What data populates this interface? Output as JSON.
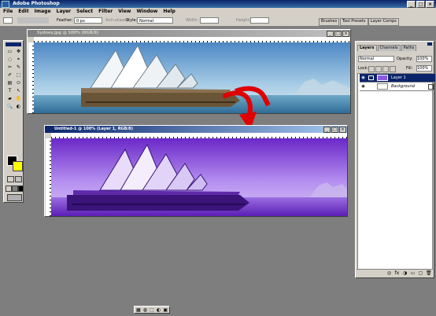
{
  "app": {
    "title": "Adobe Photoshop",
    "min": "_",
    "max": "□",
    "close": "×"
  },
  "menu": [
    "File",
    "Edit",
    "Image",
    "Layer",
    "Select",
    "Filter",
    "View",
    "Window",
    "Help"
  ],
  "options": {
    "feather_label": "Feather:",
    "feather_value": "0 px",
    "antialias_label": "Anti-aliased",
    "style_label": "Style:",
    "style_value": "Normal",
    "width_label": "Width:",
    "height_label": "Height:",
    "wells": [
      "Brushes",
      "Tool Presets",
      "Layer Comps"
    ]
  },
  "toolbox": {
    "tools": [
      "▭",
      "✥",
      "◌",
      "⌖",
      "✂",
      "✎",
      "✐",
      "⬚",
      "▤",
      "⬭",
      "T",
      "↖",
      "▰",
      "✋",
      "🔍",
      "◐"
    ],
    "fg_color": "#000000",
    "bg_color": "#ffff00"
  },
  "doc1": {
    "title": "Sydney.jpg @ 100% (RGB/8)",
    "min": "_",
    "max": "□",
    "close": "×"
  },
  "doc2": {
    "title": "Untitled-1 @ 100% (Layer 1, RGB/8)",
    "min": "_",
    "max": "□",
    "close": "×"
  },
  "layers_panel": {
    "tabs": [
      "Layers",
      "Channels",
      "Paths"
    ],
    "blend_mode": "Normal",
    "opacity_label": "Opacity:",
    "opacity_value": "100%",
    "lock_label": "Lock:",
    "fill_label": "Fill:",
    "fill_value": "100%",
    "layers": [
      {
        "name": "Layer 1",
        "selected": true
      },
      {
        "name": "Background",
        "selected": false
      }
    ],
    "bottom_icons": [
      "◎",
      "fx",
      "◑",
      "▭",
      "▢",
      "🗑"
    ]
  },
  "taskbar_icons": [
    "▦",
    "◍",
    "⬚",
    "◐",
    "▣"
  ],
  "colors": {
    "arrow": "#e00000",
    "accent": "#0a246a",
    "purple": "#7a3cd8"
  }
}
